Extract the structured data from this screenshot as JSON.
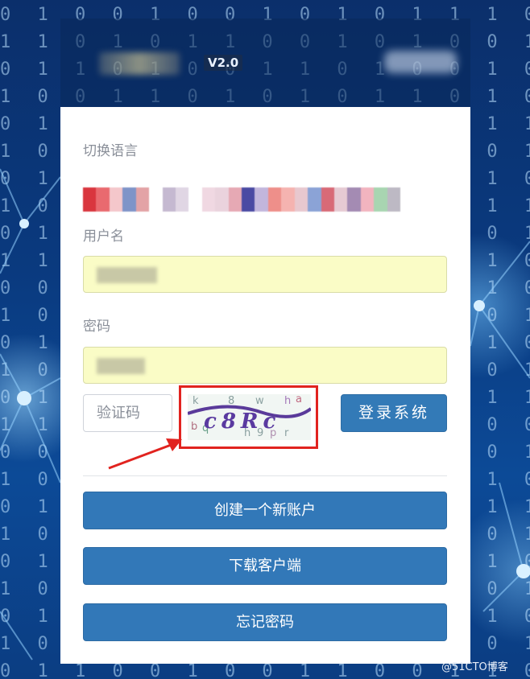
{
  "header": {
    "version": "V2.0"
  },
  "form": {
    "language_label": "切换语言",
    "username_label": "用户名",
    "password_label": "密码",
    "captcha_placeholder": "验证码",
    "captcha_text": "c8Rc",
    "login_button": "登录系统"
  },
  "actions": {
    "create_account": "创建一个新账户",
    "download_client": "下载客户端",
    "forgot_password": "忘记密码"
  },
  "footer": {
    "watermark": "@51CTO博客"
  },
  "colors": {
    "primary": "#337ab7",
    "autofill_bg": "#fafcc6",
    "highlight_red": "#e1231f"
  }
}
